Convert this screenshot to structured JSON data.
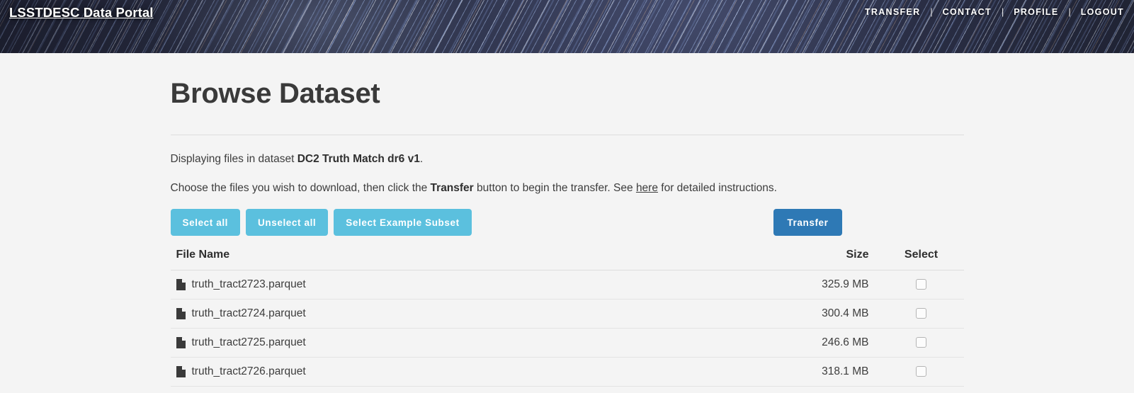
{
  "header": {
    "brand": "LSSTDESC Data Portal",
    "separator": "|",
    "nav": [
      {
        "label": "TRANSFER"
      },
      {
        "label": "CONTACT"
      },
      {
        "label": "PROFILE"
      },
      {
        "label": "LOGOUT"
      }
    ]
  },
  "main": {
    "page_title": "Browse Dataset",
    "intro": {
      "prefix": "Displaying files in dataset ",
      "dataset_name": "DC2 Truth Match dr6 v1",
      "suffix": "."
    },
    "instructions": {
      "part1": "Choose the files you wish to download, then click the ",
      "bold1": "Transfer",
      "part2": " button to begin the transfer. See ",
      "link": "here",
      "part3": " for detailed instructions."
    },
    "buttons": {
      "select_all": "Select all",
      "unselect_all": "Unselect all",
      "select_example_subset": "Select Example Subset",
      "transfer": "Transfer"
    },
    "table": {
      "headers": {
        "file_name": "File Name",
        "size": "Size",
        "select": "Select"
      },
      "rows": [
        {
          "icon": "file-icon",
          "name": "truth_tract2723.parquet",
          "size": "325.9 MB",
          "checked": false
        },
        {
          "icon": "file-icon",
          "name": "truth_tract2724.parquet",
          "size": "300.4 MB",
          "checked": false
        },
        {
          "icon": "file-icon",
          "name": "truth_tract2725.parquet",
          "size": "246.6 MB",
          "checked": false
        },
        {
          "icon": "file-icon",
          "name": "truth_tract2726.parquet",
          "size": "318.1 MB",
          "checked": false
        }
      ]
    }
  },
  "colors": {
    "button_info": "#5bc0de",
    "button_primary": "#2e79b5",
    "page_background": "#f4f4f4",
    "banner_base": "#2c3042",
    "text": "#3d3d3d"
  }
}
